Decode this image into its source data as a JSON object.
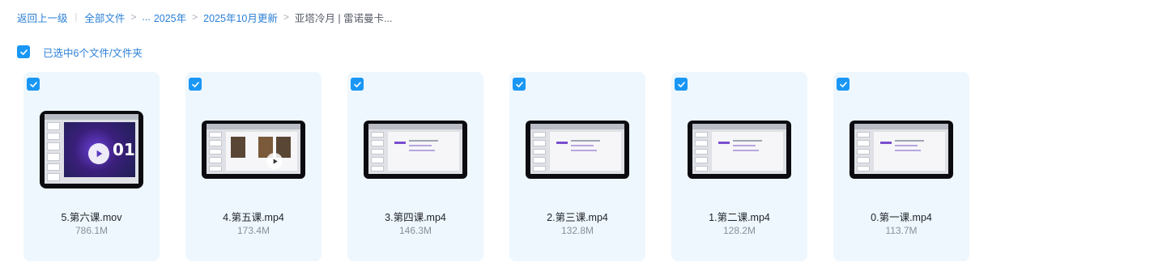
{
  "breadcrumb": {
    "back": "返回上一级",
    "all_files": "全部文件",
    "ellipsis": "...",
    "year": "2025年",
    "month": "2025年10月更新",
    "current": "亚塔冷月 | 雷诺曼卡..."
  },
  "selection": {
    "checked": true,
    "text": "已选中6个文件/文件夹"
  },
  "files": [
    {
      "name": "5.第六课.mov",
      "size": "786.1M",
      "thumb_style": "title",
      "thumb_text": "01",
      "checked": true
    },
    {
      "name": "4.第五课.mp4",
      "size": "173.4M",
      "thumb_style": "photos",
      "checked": true
    },
    {
      "name": "3.第四课.mp4",
      "size": "146.3M",
      "thumb_style": "slide",
      "checked": true
    },
    {
      "name": "2.第三课.mp4",
      "size": "132.8M",
      "thumb_style": "slide",
      "checked": true
    },
    {
      "name": "1.第二课.mp4",
      "size": "128.2M",
      "thumb_style": "slide",
      "checked": true
    },
    {
      "name": "0.第一课.mp4",
      "size": "113.7M",
      "thumb_style": "slide",
      "checked": true
    }
  ],
  "colors": {
    "accent": "#1a97f5",
    "link": "#2b7fd6",
    "card_bg": "#eef7fd"
  }
}
